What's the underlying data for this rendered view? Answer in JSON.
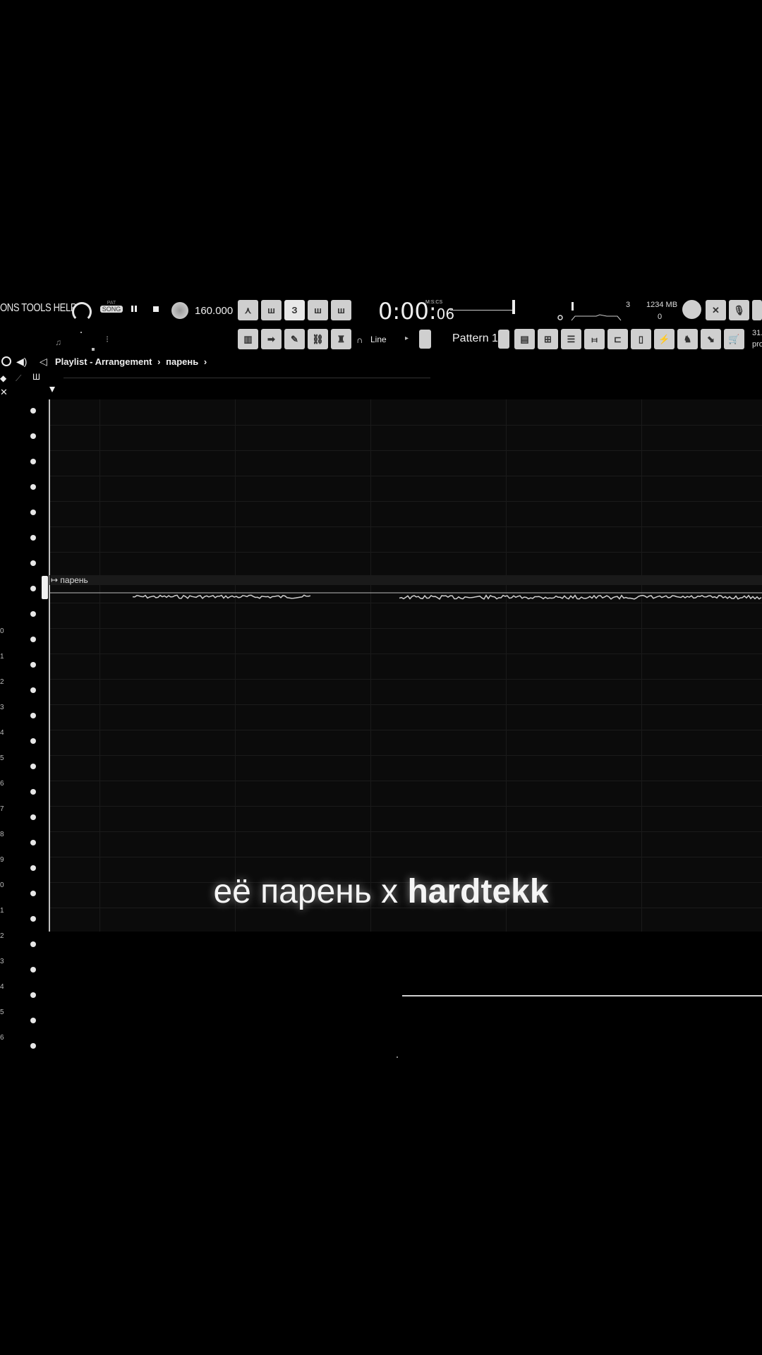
{
  "menu": {
    "text": "ONS TOOLS HELP"
  },
  "transport": {
    "pat_label": "PAT",
    "song_label": "SONG",
    "tempo": "160.000",
    "time_main": "0:00:",
    "time_sub": "06",
    "time_format": "M:S:CS"
  },
  "monitor": {
    "cpu_value": "3",
    "memory": "1234 MB",
    "poly": "0"
  },
  "snap": {
    "label": "Line"
  },
  "pattern": {
    "label": "Pattern 1"
  },
  "right_edge": {
    "top": "31.",
    "bottom": "pro"
  },
  "playlist": {
    "title": "Playlist - Arrangement",
    "separator1": "›",
    "clip_name": "парень",
    "separator2": "›"
  },
  "clip": {
    "label": "парень"
  },
  "track_numbers": [
    "0",
    "1",
    "2",
    "3",
    "4",
    "5",
    "6",
    "7",
    "8",
    "9",
    "0",
    "1",
    "2",
    "3",
    "4",
    "5",
    "6"
  ],
  "caption": {
    "part1": "её парень x ",
    "part2": "hardtekk"
  },
  "colors": {
    "background": "#000000",
    "grid": "#0b0b0b",
    "waveform": "#d0d0d0"
  }
}
